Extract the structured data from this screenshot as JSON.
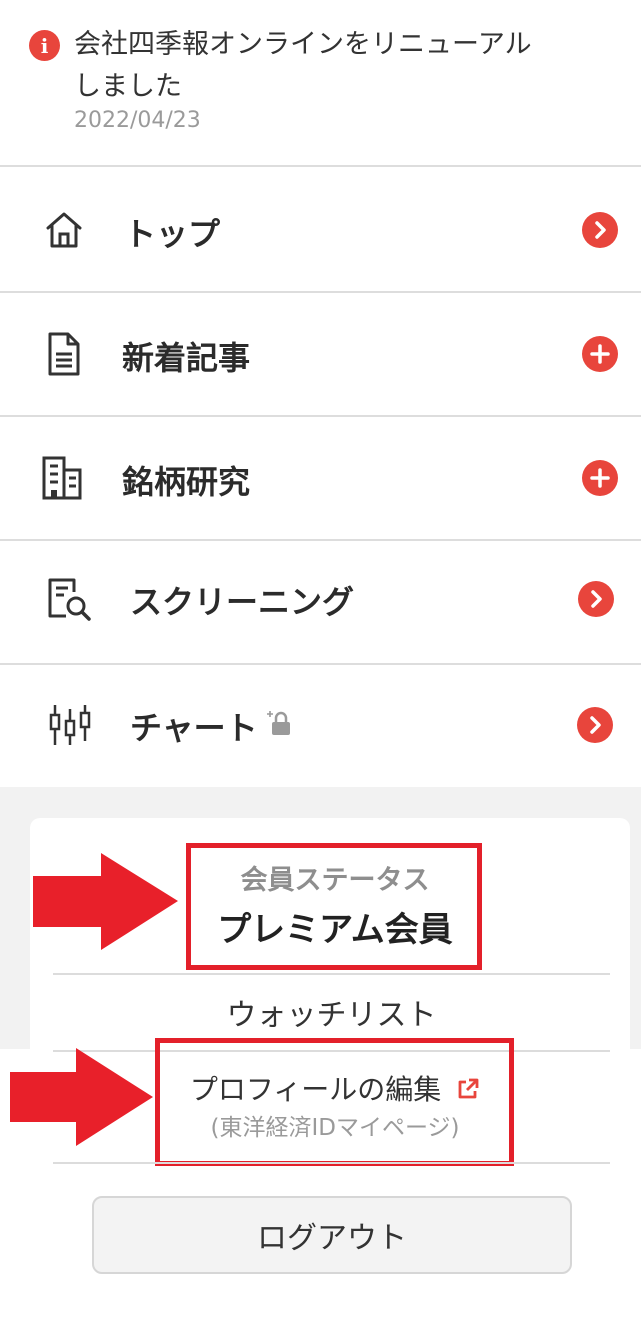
{
  "notice": {
    "title": "会社四季報オンラインをリニューアルしました",
    "date": "2022/04/23",
    "icon": "info-icon"
  },
  "menu": {
    "items": [
      {
        "label": "トップ",
        "icon": "home-icon",
        "action": "chevron-right"
      },
      {
        "label": "新着記事",
        "icon": "document-icon",
        "action": "plus"
      },
      {
        "label": "銘柄研究",
        "icon": "building-icon",
        "action": "plus"
      },
      {
        "label": "スクリーニング",
        "icon": "search-document-icon",
        "action": "chevron-right"
      },
      {
        "label": "チャート",
        "icon": "candlestick-icon",
        "action": "chevron-right",
        "locked": true
      }
    ]
  },
  "account": {
    "status_caption": "会員ステータス",
    "status_value": "プレミアム会員",
    "watchlist": "ウォッチリスト",
    "profile_edit": "プロフィールの編集",
    "profile_sub": "(東洋経済IDマイページ)",
    "logout": "ログアウト"
  },
  "colors": {
    "accent": "#e8453c",
    "highlight": "#e3202a",
    "divider": "#dddddd"
  }
}
